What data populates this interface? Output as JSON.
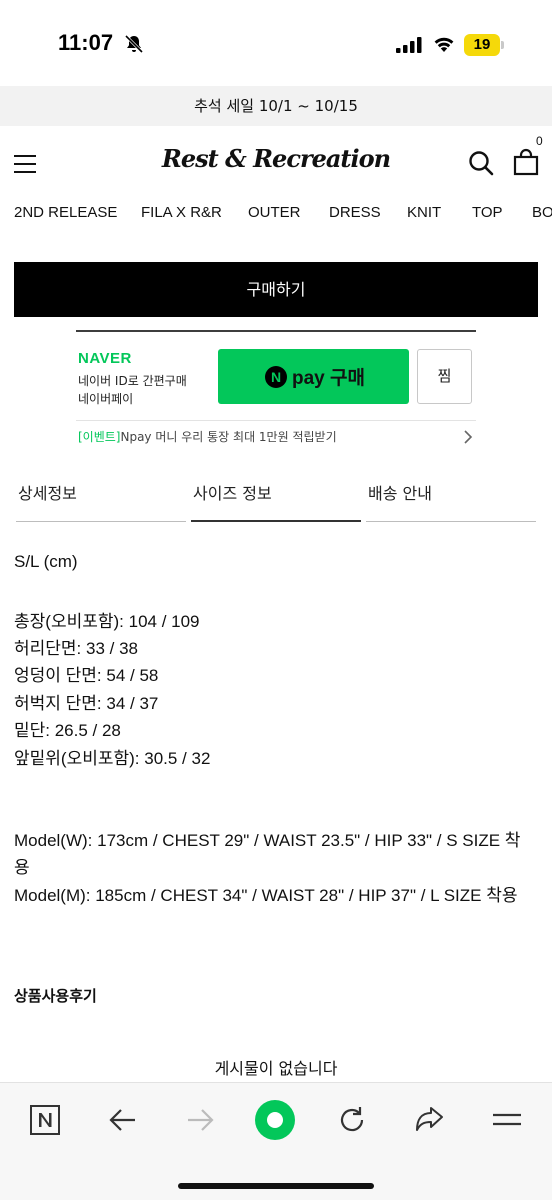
{
  "status_bar": {
    "time": "11:07",
    "battery": "19"
  },
  "promo_banner": "추석 세일 10/1 ~ 10/15",
  "header": {
    "logo": "Rest & Recreation",
    "cart_count": "0"
  },
  "categories": [
    "2ND RELEASE",
    "FILA X R&R",
    "OUTER",
    "DRESS",
    "KNIT",
    "TOP",
    "BO"
  ],
  "buy_button": "구매하기",
  "npay": {
    "brand": "NAVER",
    "line1": "네이버 ID로 간편구매",
    "line2": "네이버페이",
    "button_icon": "N",
    "button_text": "pay 구매",
    "wish_label": "찜",
    "event_tag": "[이벤트]",
    "event_text": "Npay 머니 우리 통장 최대 1만원 적립받기"
  },
  "tabs": [
    {
      "label": "상세정보",
      "active": false
    },
    {
      "label": "사이즈 정보",
      "active": true
    },
    {
      "label": "배송 안내",
      "active": false
    }
  ],
  "size_info": {
    "unit_line": "S/L (cm)",
    "measurements": [
      "총장(오비포함): 104 / 109",
      "허리단면: 33 / 38",
      "엉덩이 단면: 54 / 58",
      "허벅지 단면: 34 / 37",
      "밑단: 26.5 / 28",
      "앞밑위(오비포함): 30.5 / 32"
    ],
    "models": [
      "Model(W): 173cm / CHEST 29\" / WAIST 23.5\" / HIP 33\" / S SIZE 착",
      "용",
      "Model(M): 185cm / CHEST 34\" / WAIST 28\" / HIP 37\" / L SIZE 착용"
    ]
  },
  "reviews": {
    "title": "상품사용후기",
    "empty_text": "게시물이 없습니다"
  },
  "bottom_bar": {
    "icons": [
      "naver-n-icon",
      "back-arrow-icon",
      "forward-arrow-icon",
      "green-dot-icon",
      "reload-icon",
      "share-icon",
      "menu-lines-icon"
    ],
    "accent_color": "#03c75a"
  }
}
